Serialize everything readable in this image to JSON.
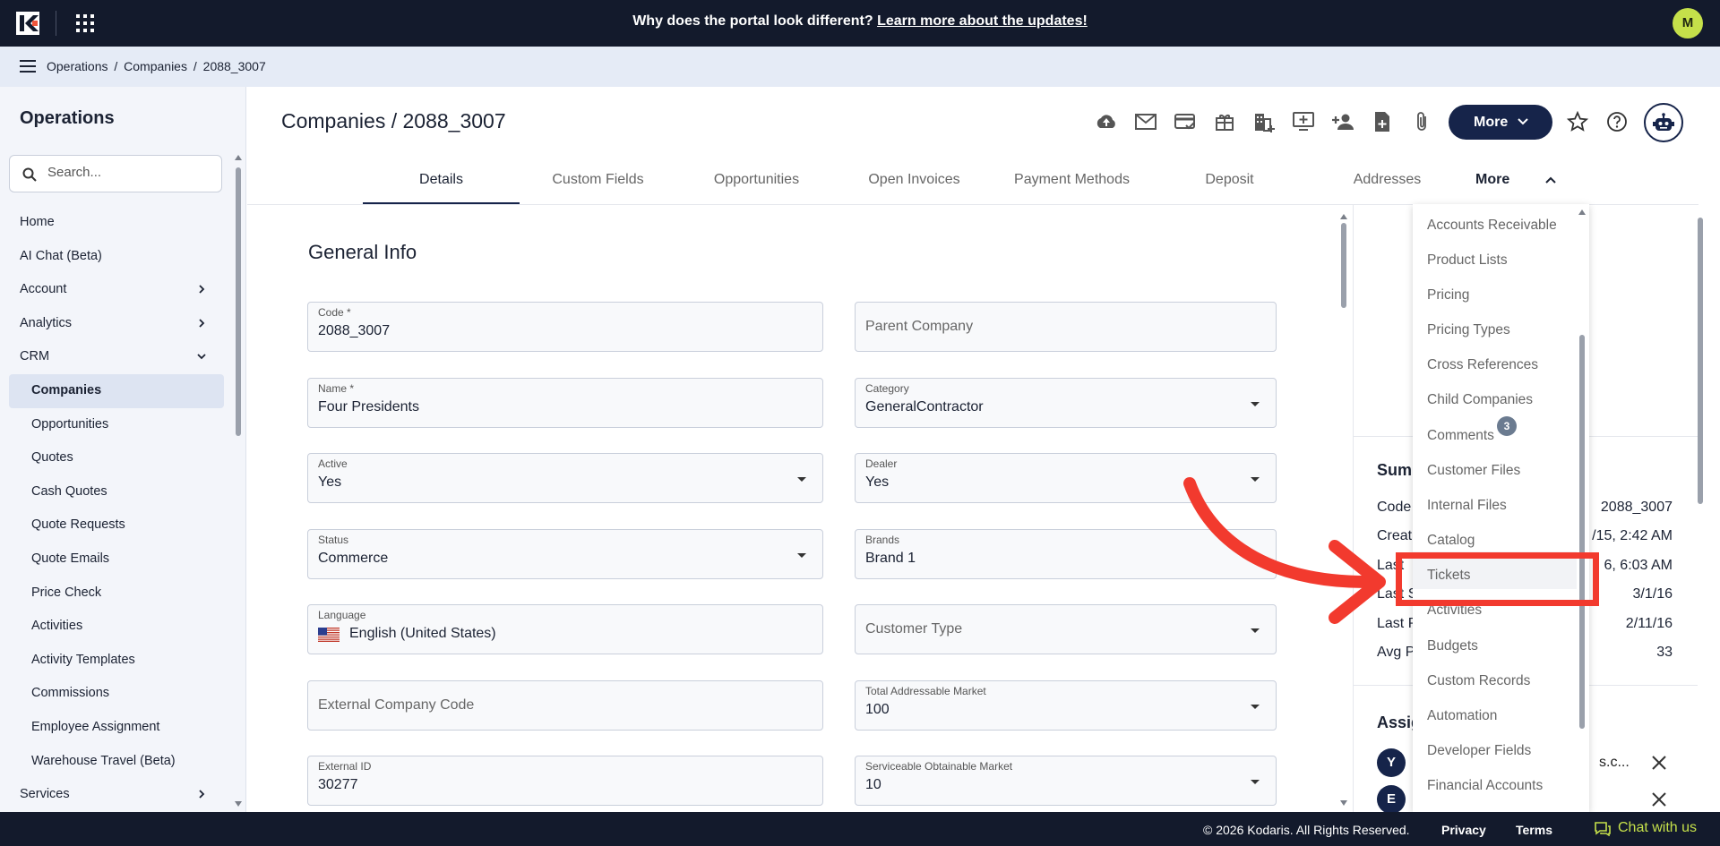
{
  "banner": {
    "text": "Why does the portal look different?",
    "link": "Learn more about the updates!"
  },
  "user": {
    "initial": "M"
  },
  "breadcrumb": [
    "Operations",
    "/",
    "Companies",
    "/",
    "2088_3007"
  ],
  "sidebar": {
    "title": "Operations",
    "search_placeholder": "Search...",
    "items": [
      {
        "label": "Home"
      },
      {
        "label": "AI Chat (Beta)"
      },
      {
        "label": "Account"
      },
      {
        "label": "Analytics"
      },
      {
        "label": "CRM"
      },
      {
        "label": "Companies"
      },
      {
        "label": "Opportunities"
      },
      {
        "label": "Quotes"
      },
      {
        "label": "Cash Quotes"
      },
      {
        "label": "Quote Requests"
      },
      {
        "label": "Quote Emails"
      },
      {
        "label": "Price Check"
      },
      {
        "label": "Activities"
      },
      {
        "label": "Activity Templates"
      },
      {
        "label": "Commissions"
      },
      {
        "label": "Employee Assignment"
      },
      {
        "label": "Warehouse Travel (Beta)"
      },
      {
        "label": "Services"
      }
    ]
  },
  "page": {
    "title": "Companies / 2088_3007",
    "more_button": "More"
  },
  "tabs": [
    "Details",
    "Custom Fields",
    "Opportunities",
    "Open Invoices",
    "Payment Methods",
    "Deposit",
    "Addresses",
    "More"
  ],
  "form": {
    "section_title": "General Info",
    "code": {
      "label": "Code *",
      "value": "2088_3007"
    },
    "parent_company": {
      "placeholder": "Parent Company"
    },
    "name": {
      "label": "Name *",
      "value": "Four Presidents"
    },
    "category": {
      "label": "Category",
      "value": "GeneralContractor"
    },
    "active": {
      "label": "Active",
      "value": "Yes"
    },
    "dealer": {
      "label": "Dealer",
      "value": "Yes"
    },
    "status": {
      "label": "Status",
      "value": "Commerce"
    },
    "brands": {
      "label": "Brands",
      "value": "Brand 1"
    },
    "language": {
      "label": "Language",
      "value": "English (United States)"
    },
    "customer_type": {
      "placeholder": "Customer Type"
    },
    "external_company_code": {
      "placeholder": "External Company Code"
    },
    "total_addressable_market": {
      "label": "Total Addressable Market",
      "value": "100"
    },
    "external_id": {
      "label": "External ID",
      "value": "30277"
    },
    "serviceable_obtainable_market": {
      "label": "Serviceable Obtainable Market",
      "value": "10"
    }
  },
  "summary": {
    "title_partial": "Sum",
    "rows": [
      {
        "label": "Code",
        "value": "2088_3007"
      },
      {
        "label": "Creat",
        "value": "/15, 2:42 AM"
      },
      {
        "label": "Last",
        "value": "6, 6:03 AM"
      },
      {
        "label": "Last S",
        "value": "3/1/16"
      },
      {
        "label": "Last P",
        "value": "2/11/16"
      },
      {
        "label": "Avg P",
        "value": "33"
      }
    ],
    "assigned_title_partial": "Assig",
    "assignees": [
      {
        "initial": "Y",
        "text": "s.c..."
      },
      {
        "initial": "E",
        "text": ""
      }
    ]
  },
  "more_menu": {
    "items": [
      "Accounts Receivable",
      "Product Lists",
      "Pricing",
      "Pricing Types",
      "Cross References",
      "Child Companies",
      "Comments",
      "Customer Files",
      "Internal Files",
      "Catalog",
      "Tickets",
      "Activities",
      "Budgets",
      "Custom Records",
      "Automation",
      "Developer Fields",
      "Financial Accounts"
    ],
    "comments_badge": "3",
    "highlighted": "Tickets",
    "annotation_color": "#f23a2e"
  },
  "footer": {
    "copyright": "© 2026 Kodaris. All Rights Reserved.",
    "privacy": "Privacy",
    "terms": "Terms",
    "chat": "Chat with us"
  },
  "colors": {
    "navy": "#131a2c",
    "primary": "#16244a",
    "accent_lime": "#c5e04a"
  }
}
